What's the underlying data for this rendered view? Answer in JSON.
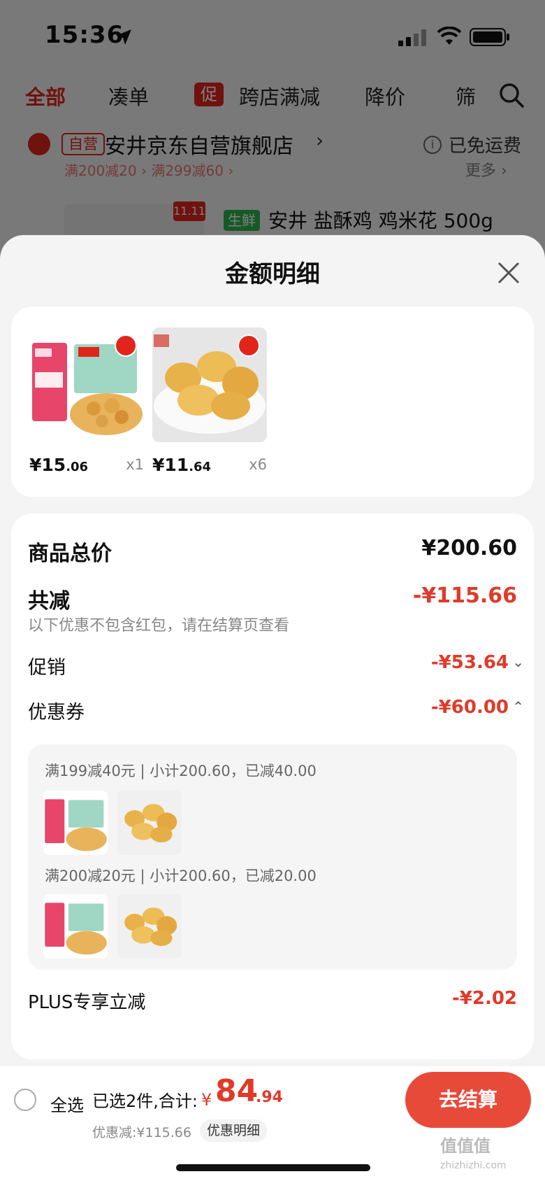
{
  "status_bar": {
    "time": "15:36"
  },
  "tabs": {
    "all": "全部",
    "cou": "凑单",
    "promo_badge": "促",
    "cross_store": "跨店满减",
    "price_drop": "降价",
    "filter": "筛"
  },
  "store": {
    "self_badge": "自营",
    "name": "安井京东自营旗舰店",
    "free_shipping": "已免运费",
    "coupon_strip": "满200减20 › 满299减60 ›",
    "more": "更多 ›",
    "tag_1111": "11.11",
    "fresh_badge": "生鲜",
    "product_title": "安井 盐酥鸡 鸡米花 500g"
  },
  "sheet": {
    "title": "金额明细",
    "items": [
      {
        "price_int": "¥15",
        "price_dec": ".06",
        "qty": "x1"
      },
      {
        "price_int": "¥11",
        "price_dec": ".64",
        "qty": "x6"
      }
    ],
    "total_label": "商品总价",
    "total_value": "¥200.60",
    "reduce_label": "共减",
    "reduce_value": "-¥115.66",
    "note": "以下优惠不包含红包，请在结算页查看",
    "promo_label": "促销",
    "promo_value": "-¥53.64",
    "coupon_label": "优惠券",
    "coupon_value": "-¥60.00",
    "coupon_lines": [
      "满199减40元 | 小计200.60，已减40.00",
      "满200减20元 | 小计200.60，已减20.00"
    ],
    "plus_label": "PLUS专享立减",
    "plus_value": "-¥2.02"
  },
  "bottom": {
    "select_all": "全选",
    "selected": "已选2件,合计:",
    "amount_symbol": "¥",
    "amount_int": "84",
    "amount_dec": ".94",
    "saved": "优惠减:¥115.66",
    "detail_pill": "优惠明细",
    "checkout": "去结算",
    "watermark": "值值值",
    "watermark_sub": "zhizhizhi.com"
  },
  "colors": {
    "accent": "#e1251b",
    "discount": "#e03a2a",
    "checkout": "#e84a3a"
  }
}
